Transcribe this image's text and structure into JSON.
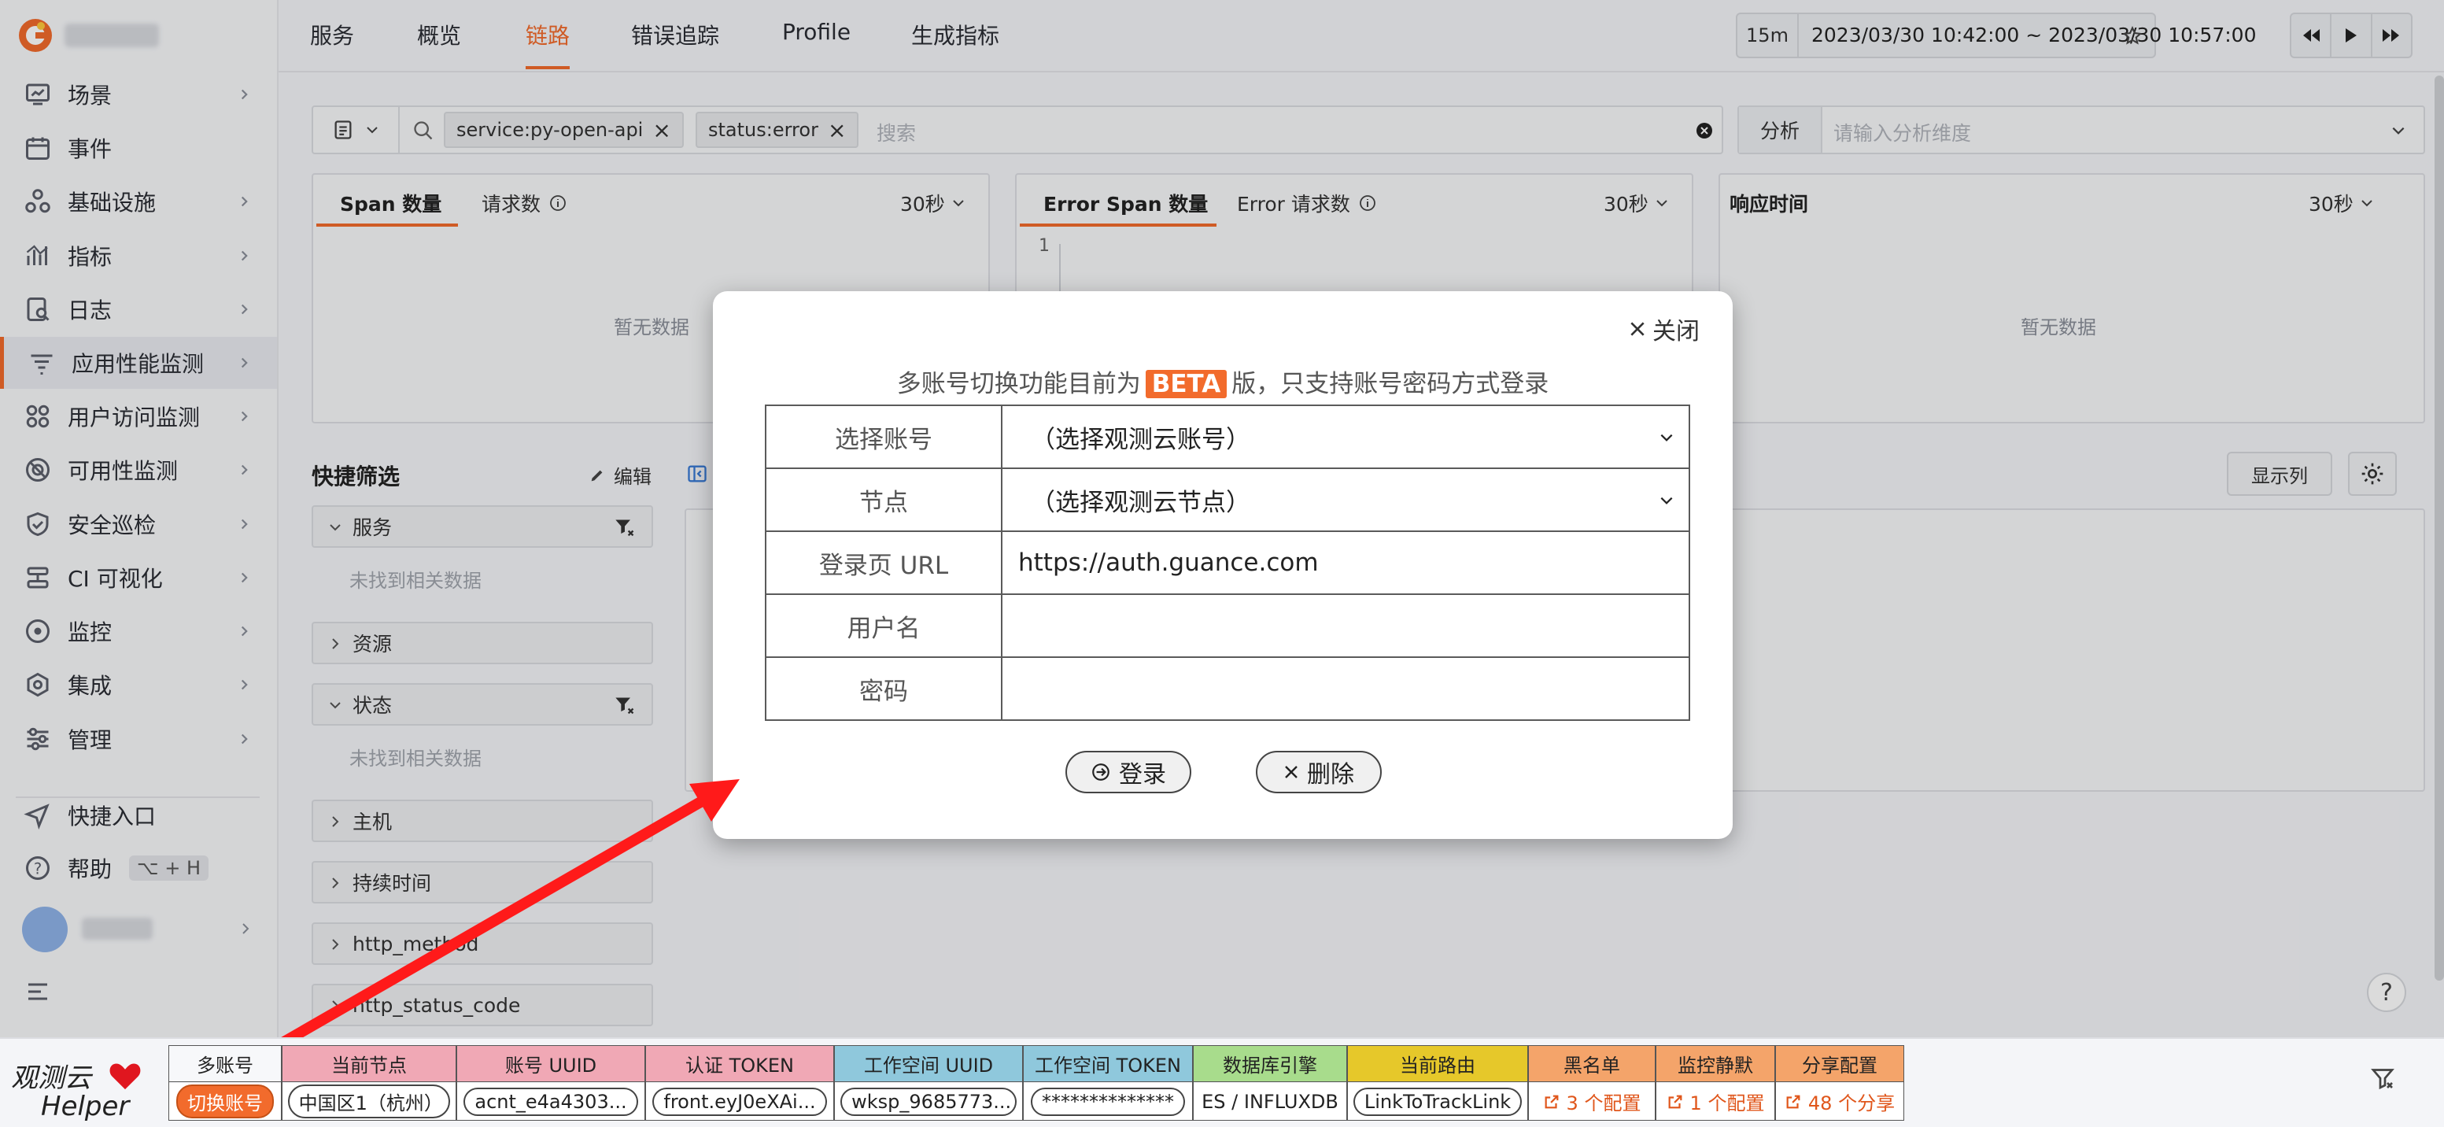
{
  "app": {
    "logo_text": "G"
  },
  "sidebar": {
    "items": [
      {
        "label": "场景",
        "icon": "dashboard-icon",
        "chevron": true
      },
      {
        "label": "事件",
        "icon": "calendar-icon",
        "chevron": false
      },
      {
        "label": "基础设施",
        "icon": "infrastructure-icon",
        "chevron": true
      },
      {
        "label": "指标",
        "icon": "metrics-icon",
        "chevron": true
      },
      {
        "label": "日志",
        "icon": "log-icon",
        "chevron": true
      },
      {
        "label": "应用性能监测",
        "icon": "apm-icon",
        "chevron": true
      },
      {
        "label": "用户访问监测",
        "icon": "rum-icon",
        "chevron": true
      },
      {
        "label": "可用性监测",
        "icon": "availability-icon",
        "chevron": true
      },
      {
        "label": "安全巡检",
        "icon": "shield-icon",
        "chevron": true
      },
      {
        "label": "CI 可视化",
        "icon": "ci-icon",
        "chevron": true
      },
      {
        "label": "监控",
        "icon": "monitor-icon",
        "chevron": true
      },
      {
        "label": "集成",
        "icon": "integration-icon",
        "chevron": true
      },
      {
        "label": "管理",
        "icon": "settings-sliders-icon",
        "chevron": true
      }
    ],
    "shortcut": "快捷入口",
    "help": "帮助",
    "help_keys": "⌥ + H"
  },
  "header": {
    "tabs": [
      "服务",
      "概览",
      "链路",
      "错误追踪",
      "Profile",
      "生成指标"
    ],
    "active_tab": 2,
    "time_quick": "15m",
    "time_range": "2023/03/30 10:42:00 ~ 2023/03/30 10:57:00"
  },
  "search": {
    "tags": [
      "service:py-open-api",
      "status:error"
    ],
    "placeholder": "搜索",
    "analysis_label": "分析",
    "analysis_placeholder": "请输入分析维度"
  },
  "charts": [
    {
      "tabs": [
        "Span 数量",
        "请求数"
      ],
      "interval": "30秒",
      "empty": "暂无数据"
    },
    {
      "tabs": [
        "Error Span 数量",
        "Error 请求数"
      ],
      "interval": "30秒",
      "axis_tick": "1"
    },
    {
      "title": "响应时间",
      "interval": "30秒",
      "empty": "暂无数据"
    }
  ],
  "quick_filter": {
    "title": "快捷筛选",
    "edit": "编辑",
    "groups": [
      {
        "label": "服务",
        "expanded": true,
        "empty": "未找到相关数据"
      },
      {
        "label": "资源",
        "expanded": false
      },
      {
        "label": "状态",
        "expanded": true,
        "empty": "未找到相关数据"
      },
      {
        "label": "主机",
        "expanded": false
      },
      {
        "label": "持续时间",
        "expanded": false
      },
      {
        "label": "http_method",
        "expanded": false
      },
      {
        "label": "http_status_code",
        "expanded": false
      }
    ]
  },
  "list": {
    "columns_button": "显示列"
  },
  "modal": {
    "close": "关闭",
    "notice_prefix": "多账号切换功能目前为",
    "notice_badge": "BETA",
    "notice_suffix": "版，只支持账号密码方式登录",
    "fields": [
      {
        "label": "选择账号",
        "value": "（选择观测云账号）",
        "select": true
      },
      {
        "label": "节点",
        "value": "（选择观测云节点）",
        "select": true
      },
      {
        "label": "登录页 URL",
        "value": "https://auth.guance.com",
        "select": false
      },
      {
        "label": "用户名",
        "value": "",
        "select": false
      },
      {
        "label": "密码",
        "value": "",
        "select": false
      }
    ],
    "login_button": "登录",
    "delete_button": "删除"
  },
  "helper": {
    "brand_line1": "观测云",
    "brand_line2": "Helper",
    "columns": [
      {
        "header": "多账号",
        "value": "切换账号",
        "color": "#f7f8fa",
        "kind": "orange-pill"
      },
      {
        "header": "当前节点",
        "value": "中国区1（杭州）",
        "color": "#f0a8b5",
        "kind": "pill"
      },
      {
        "header": "账号 UUID",
        "value": "acnt_e4a4303...",
        "color": "#f0a8b5",
        "kind": "pill"
      },
      {
        "header": "认证 TOKEN",
        "value": "front.eyJ0eXAi...",
        "color": "#f0a8b5",
        "kind": "pill"
      },
      {
        "header": "工作空间 UUID",
        "value": "wksp_9685773...",
        "color": "#8fc8dc",
        "kind": "pill"
      },
      {
        "header": "工作空间 TOKEN",
        "value": "**************",
        "color": "#8fc8dc",
        "kind": "pill"
      },
      {
        "header": "数据库引擎",
        "value": "ES / INFLUXDB",
        "color": "#a8dc8c",
        "kind": "text"
      },
      {
        "header": "当前路由",
        "value": "LinkToTrackLink",
        "color": "#e6c82a",
        "kind": "pill"
      },
      {
        "header": "黑名单",
        "value": "3 个配置",
        "color": "#f4a46a",
        "kind": "link"
      },
      {
        "header": "监控静默",
        "value": "1 个配置",
        "color": "#f4a46a",
        "kind": "link"
      },
      {
        "header": "分享配置",
        "value": "48 个分享",
        "color": "#f4a46a",
        "kind": "link"
      }
    ]
  },
  "colors": {
    "accent": "#f26b2c",
    "arrow": "#ff1a1a",
    "beta": "#f26b2c"
  }
}
